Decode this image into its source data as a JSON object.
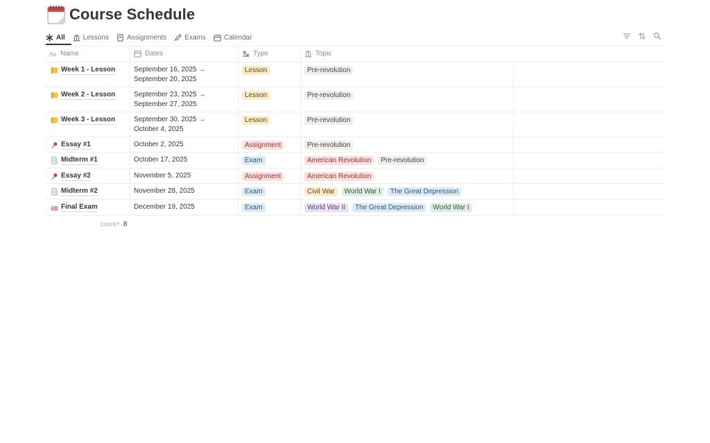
{
  "page": {
    "title": "Course Schedule",
    "icon": "calendar-icon"
  },
  "tabs": [
    {
      "label": "All",
      "icon": "asterisk-icon",
      "active": true
    },
    {
      "label": "Lessons",
      "icon": "building-columns-icon"
    },
    {
      "label": "Assignments",
      "icon": "book-icon"
    },
    {
      "label": "Exams",
      "icon": "pencil-icon"
    },
    {
      "label": "Calendar",
      "icon": "calendar-icon"
    }
  ],
  "toolbar": {
    "icons": [
      "filter-icon",
      "sort-icon",
      "search-icon"
    ]
  },
  "columns": [
    {
      "label": "Name",
      "icon": "text-aa-icon"
    },
    {
      "label": "Dates",
      "icon": "calendar-icon"
    },
    {
      "label": "Type",
      "icon": "shapes-icon"
    },
    {
      "label": "Topic",
      "icon": "building-columns-icon"
    }
  ],
  "rows": [
    {
      "name": "Week 1 - Lesson",
      "emoji": "notebook-icon",
      "dates": [
        "September 16, 2025 →",
        "September 20, 2025"
      ],
      "type": "Lesson",
      "topics": [
        {
          "label": "Pre-revolution",
          "color": "gray"
        }
      ]
    },
    {
      "name": "Week 2 - Lesson",
      "emoji": "notebook-icon",
      "dates": [
        "September 23, 2025 →",
        "September 27, 2025"
      ],
      "type": "Lesson",
      "topics": [
        {
          "label": "Pre-revolution",
          "color": "gray"
        }
      ]
    },
    {
      "name": "Week 3 - Lesson",
      "emoji": "notebook-icon",
      "dates": [
        "September 30, 2025 →",
        "October 4, 2025"
      ],
      "type": "Lesson",
      "topics": [
        {
          "label": "Pre-revolution",
          "color": "gray"
        }
      ]
    },
    {
      "name": "Essay #1",
      "emoji": "pushpin-icon",
      "dates": [
        "October 2, 2025"
      ],
      "type": "Assignment",
      "topics": [
        {
          "label": "Pre-revolution",
          "color": "gray"
        }
      ]
    },
    {
      "name": "Midterm #1",
      "emoji": "page-icon",
      "dates": [
        "October 17, 2025"
      ],
      "type": "Exam",
      "topics": [
        {
          "label": "American Revolution",
          "color": "red"
        },
        {
          "label": "Pre-revolution",
          "color": "gray"
        }
      ]
    },
    {
      "name": "Essay #2",
      "emoji": "pushpin-icon",
      "dates": [
        "November 5, 2025"
      ],
      "type": "Assignment",
      "topics": [
        {
          "label": "American Revolution",
          "color": "red"
        }
      ]
    },
    {
      "name": "Midterm #2",
      "emoji": "page-icon",
      "dates": [
        "November 28, 2025"
      ],
      "type": "Exam",
      "topics": [
        {
          "label": "Civil War",
          "color": "yellow"
        },
        {
          "label": "World War I",
          "color": "green"
        },
        {
          "label": "The Great Depression",
          "color": "blue"
        }
      ]
    },
    {
      "name": "Final Exam",
      "emoji": "hundred-points-icon",
      "dates": [
        "December 19, 2025"
      ],
      "type": "Exam",
      "topics": [
        {
          "label": "World War II",
          "color": "purple"
        },
        {
          "label": "The Great Depression",
          "color": "blue"
        },
        {
          "label": "World War I",
          "color": "green"
        }
      ]
    }
  ],
  "footer": {
    "count_label": "COUNT",
    "count_value": "8"
  }
}
